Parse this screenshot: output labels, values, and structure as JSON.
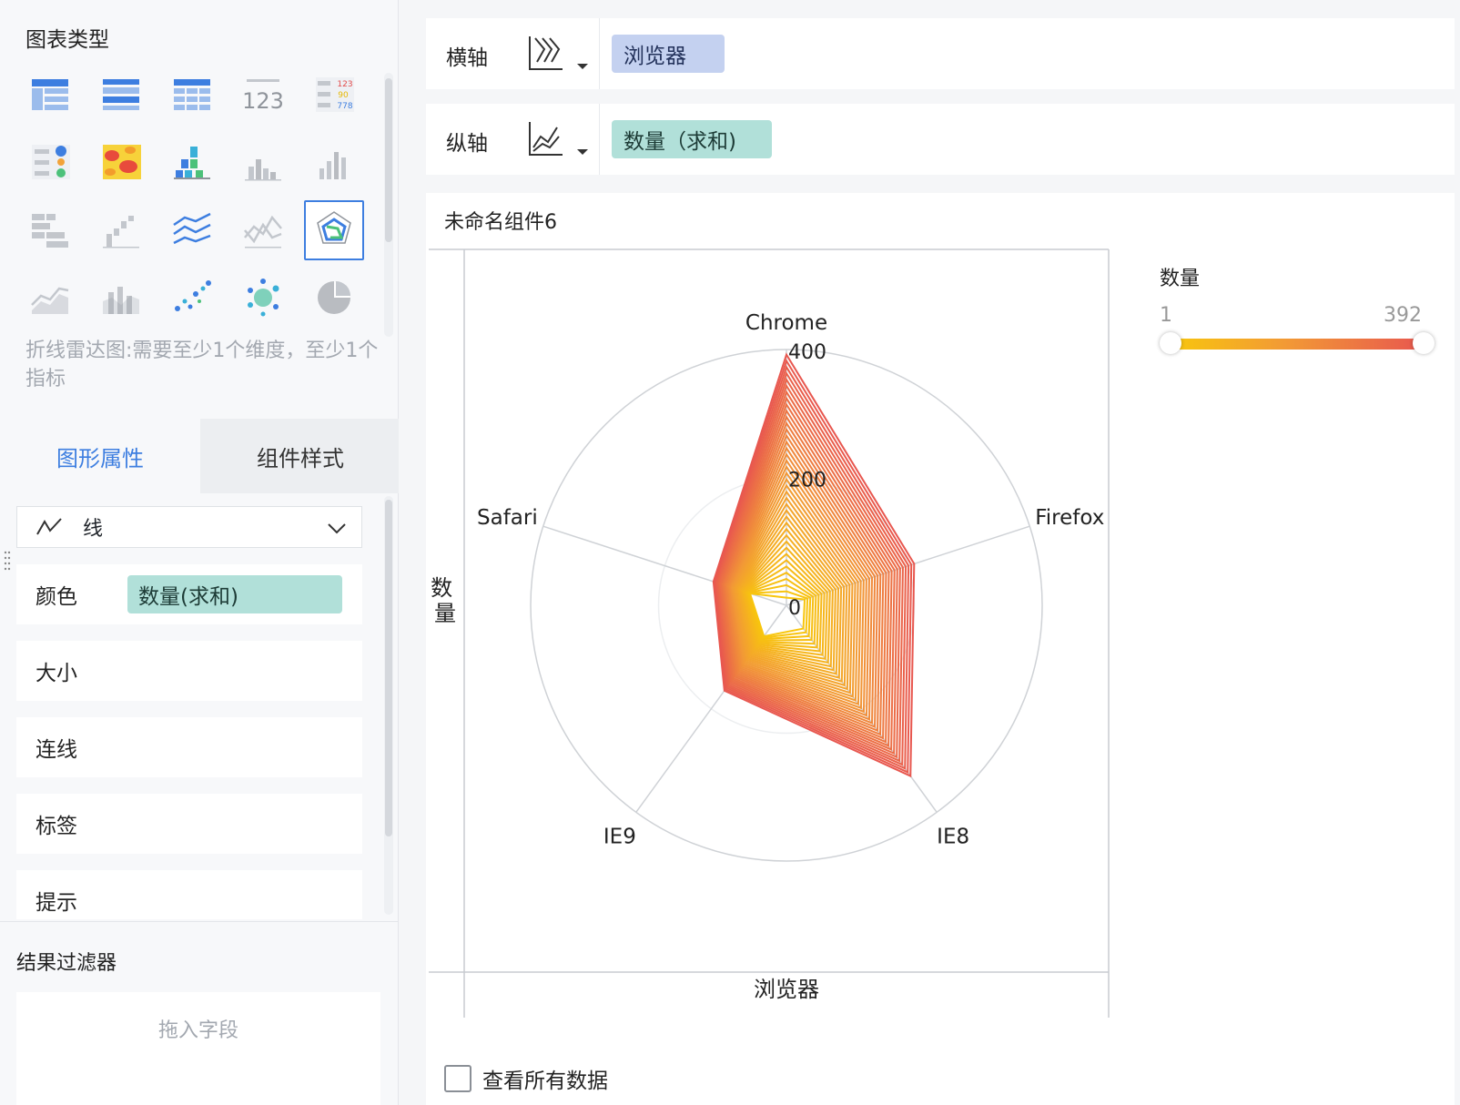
{
  "left_panel": {
    "chart_type_title": "图表类型",
    "chart_types": [
      "table-icon",
      "cross-table-icon",
      "detail-table-icon",
      "kpi-number-icon",
      "color-table-icon",
      "dot-matrix-icon",
      "heatmap-icon",
      "grouped-bar-icon",
      "stacked-column-icon",
      "column-icon",
      "bar-table-icon",
      "waterfall-icon",
      "multi-line-icon",
      "line-radar-alt-icon",
      "radar-icon",
      "area-icon",
      "column-area-icon",
      "scatter-icon",
      "bubble-icon",
      "pie-icon"
    ],
    "selected_index": 14,
    "hint": "折线雷达图:需要至少1个维度，至少1个指标",
    "tabs": {
      "active": "图形属性",
      "inactive": "组件样式"
    },
    "mark_type": {
      "icon": "line-chart-icon",
      "label": "线"
    },
    "properties": {
      "color_label": "颜色",
      "color_field": "数量(求和)",
      "size_label": "大小",
      "connect_label": "连线",
      "label_label": "标签",
      "tooltip_label": "提示"
    },
    "result_filter_title": "结果过滤器",
    "filter_placeholder": "拖入字段"
  },
  "shelves": {
    "x_label": "横轴",
    "x_field": "浏览器",
    "y_label": "纵轴",
    "y_field": "数量（求和)"
  },
  "chart_panel": {
    "component_title": "未命名组件6",
    "y_axis_title": "数量",
    "x_axis_title": "浏览器",
    "legend": {
      "title": "数量",
      "min": "1",
      "max": "392",
      "colors": [
        "#f8c60d",
        "#f29a35",
        "#e8574f"
      ]
    },
    "view_all_label": "查看所有数据"
  },
  "chart_data": {
    "type": "radar",
    "categories": [
      "Chrome",
      "Firefox",
      "IE8",
      "IE9",
      "Safari"
    ],
    "radial_ticks": [
      "0",
      "200",
      "400"
    ],
    "rmax": 400,
    "series_count": 40,
    "series_max": {
      "Chrome": 392,
      "Firefox": 210,
      "IE8": 330,
      "IE9": 165,
      "Safari": 120
    },
    "series_min": {
      "Chrome": 12,
      "Firefox": 30,
      "IE8": 45,
      "IE9": 60,
      "Safari": 60
    },
    "color_range": [
      1,
      392
    ]
  }
}
